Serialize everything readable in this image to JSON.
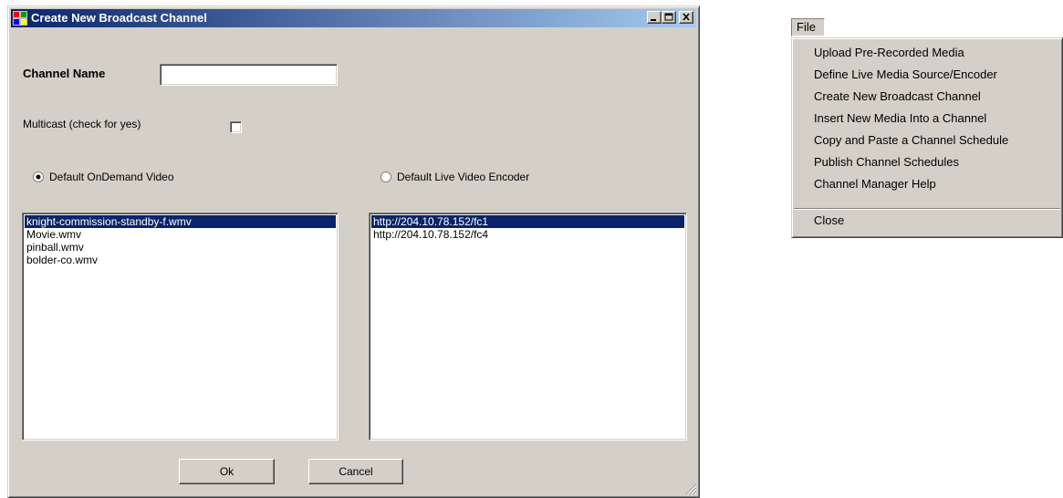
{
  "window": {
    "title": "Create New Broadcast Channel",
    "channel_name_label": "Channel Name",
    "channel_name_value": "",
    "multicast_label": "Multicast (check for yes)",
    "multicast_checked": false,
    "radio_ondemand_label": "Default OnDemand Video",
    "radio_ondemand_selected": true,
    "radio_live_label": "Default Live Video Encoder",
    "radio_live_selected": false,
    "ondemand_list": [
      {
        "label": "knight-commission-standby-f.wmv",
        "selected": true
      },
      {
        "label": "Movie.wmv",
        "selected": false
      },
      {
        "label": "pinball.wmv",
        "selected": false
      },
      {
        "label": "bolder-co.wmv",
        "selected": false
      }
    ],
    "live_list": [
      {
        "label": "http://204.10.78.152/fc1",
        "selected": true
      },
      {
        "label": "http://204.10.78.152/fc4",
        "selected": false
      }
    ],
    "ok_label": "Ok",
    "cancel_label": "Cancel"
  },
  "file_menu": {
    "title": "File",
    "items": [
      "Upload Pre-Recorded Media",
      "Define Live Media Source/Encoder",
      "Create New Broadcast Channel",
      "Insert New Media Into a Channel",
      "Copy and Paste a Channel Schedule",
      "Publish Channel Schedules",
      "Channel Manager Help"
    ],
    "close_label": "Close"
  },
  "colors": {
    "dialog_face": "#d4d0c8",
    "title_start": "#0a246a",
    "title_end": "#a6caf0",
    "selection": "#0a246a"
  },
  "icons": [
    "app-icon",
    "minimize-icon",
    "maximize-icon",
    "close-icon",
    "resize-grip-icon"
  ]
}
